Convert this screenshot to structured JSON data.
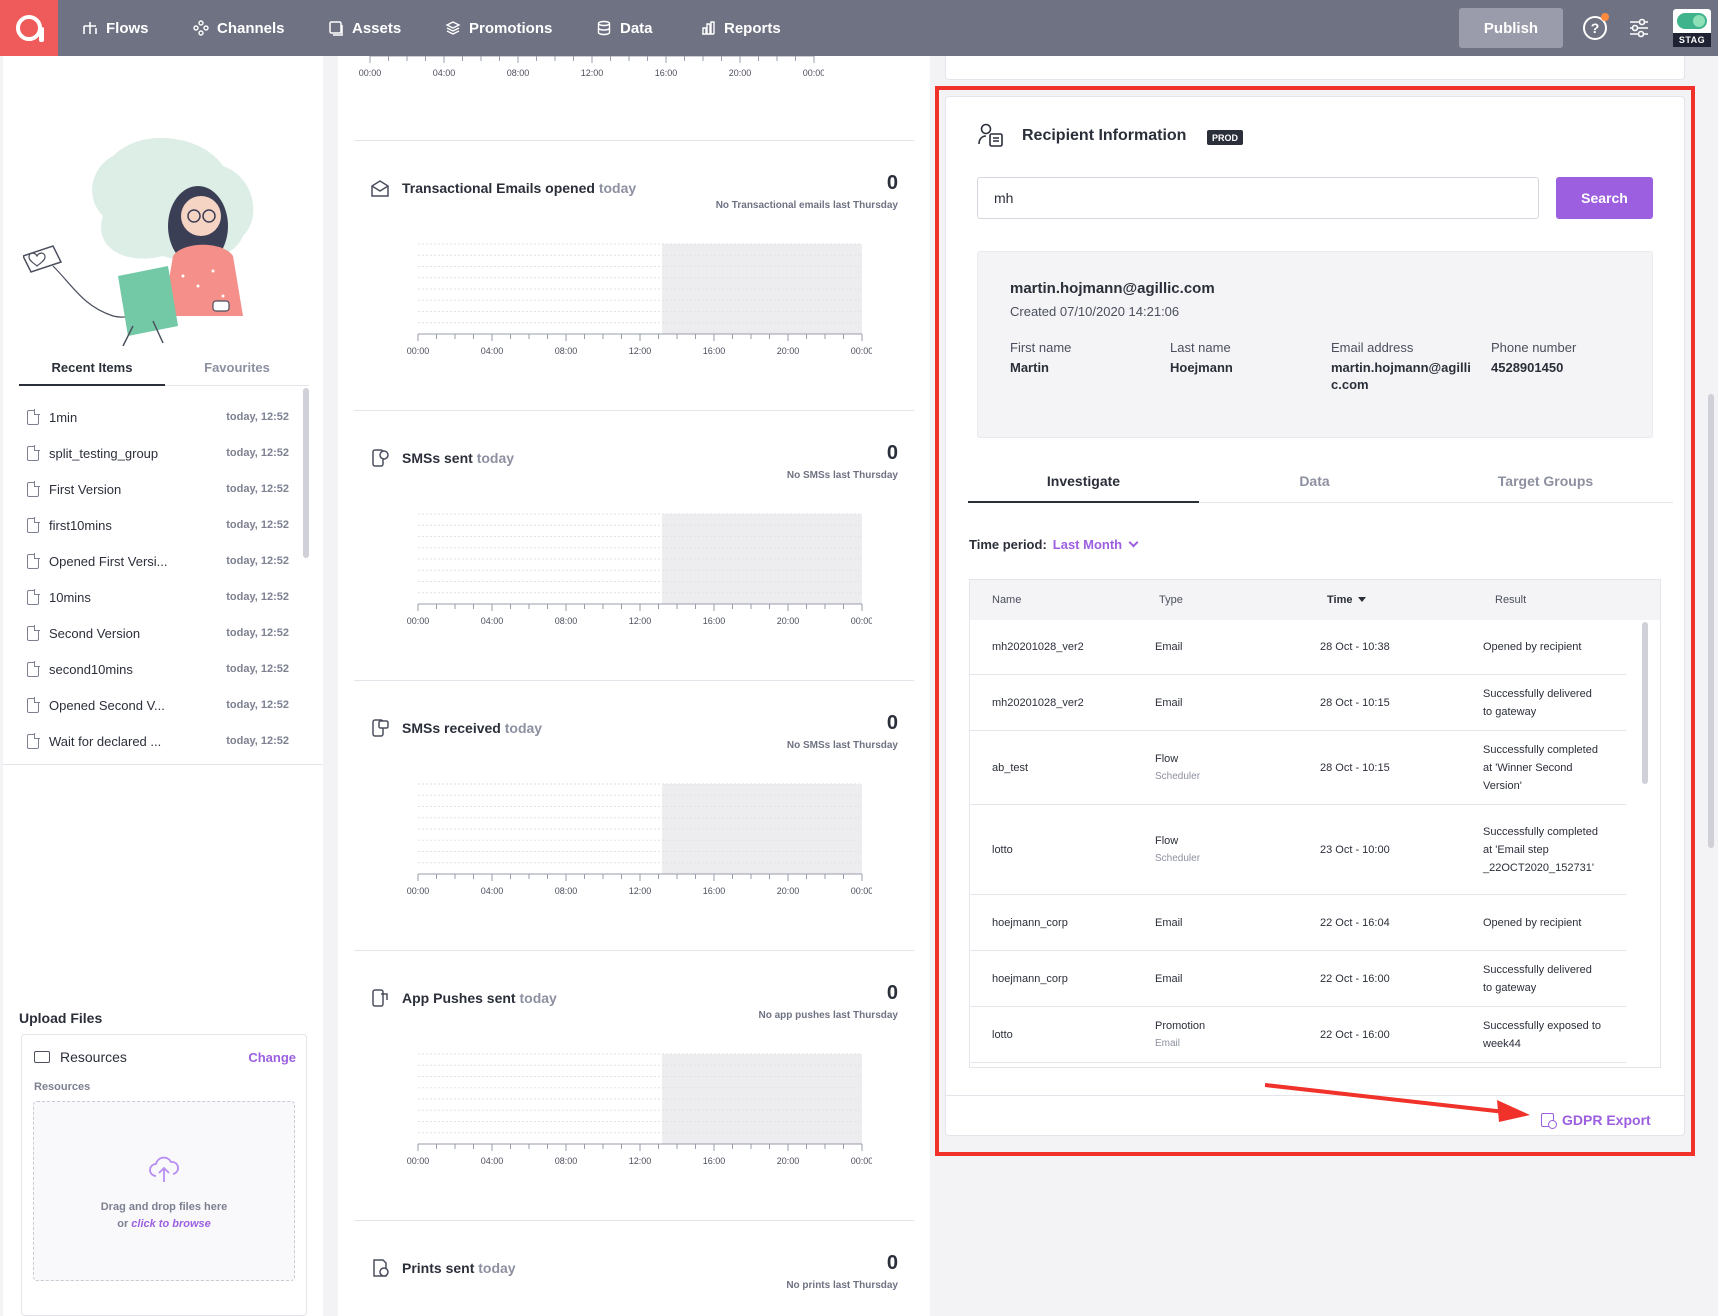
{
  "nav": {
    "items": [
      {
        "label": "Flows",
        "icon": "flows-icon"
      },
      {
        "label": "Channels",
        "icon": "channels-icon"
      },
      {
        "label": "Assets",
        "icon": "assets-icon"
      },
      {
        "label": "Promotions",
        "icon": "promotions-icon"
      },
      {
        "label": "Data",
        "icon": "database-icon"
      },
      {
        "label": "Reports",
        "icon": "reports-icon"
      }
    ],
    "publish_label": "Publish",
    "help_label": "?",
    "env_label": "STAG"
  },
  "left": {
    "tabs": {
      "recent": "Recent Items",
      "favourites": "Favourites"
    },
    "recent_items": [
      {
        "name": "1min",
        "time": "today, 12:52"
      },
      {
        "name": "split_testing_group",
        "time": "today, 12:52"
      },
      {
        "name": "First Version",
        "time": "today, 12:52"
      },
      {
        "name": "first10mins",
        "time": "today, 12:52"
      },
      {
        "name": "Opened First Versi...",
        "time": "today, 12:52"
      },
      {
        "name": "10mins",
        "time": "today, 12:52"
      },
      {
        "name": "Second Version",
        "time": "today, 12:52"
      },
      {
        "name": "second10mins",
        "time": "today, 12:52"
      },
      {
        "name": "Opened Second V...",
        "time": "today, 12:52"
      },
      {
        "name": "Wait for declared ...",
        "time": "today, 12:52"
      }
    ],
    "upload": {
      "title": "Upload Files",
      "folder_name": "Resources",
      "change_label": "Change",
      "sub_label": "Resources",
      "drop_text": "Drag and drop files here",
      "drop_or": "or",
      "drop_link": "click to browse"
    }
  },
  "chart_axis_ticks": [
    "00:00",
    "04:00",
    "08:00",
    "12:00",
    "16:00",
    "20:00",
    "00:00"
  ],
  "stats": [
    {
      "title": "Transactional Emails opened",
      "today": "today",
      "value": "0",
      "note": "No Transactional emails last Thursday",
      "icon": "envelope-open-icon"
    },
    {
      "title": "SMSs sent",
      "today": "today",
      "value": "0",
      "note": "No SMSs last Thursday",
      "icon": "sms-sent-icon"
    },
    {
      "title": "SMSs received",
      "today": "today",
      "value": "0",
      "note": "No SMSs last Thursday",
      "icon": "sms-received-icon"
    },
    {
      "title": "App Pushes sent",
      "today": "today",
      "value": "0",
      "note": "No app pushes last Thursday",
      "icon": "app-push-icon"
    },
    {
      "title": "Prints sent",
      "today": "today",
      "value": "0",
      "note": "No prints last Thursday",
      "icon": "print-icon"
    }
  ],
  "recipient": {
    "title": "Recipient Information",
    "badge": "PROD",
    "search_value": "mh",
    "search_label": "Search",
    "email": "martin.hojmann@agillic.com",
    "created": "Created 07/10/2020 14:21:06",
    "fields": [
      {
        "label": "First name",
        "value": "Martin"
      },
      {
        "label": "Last name",
        "value": "Hoejmann"
      },
      {
        "label": "Email address",
        "value": "martin.hojmann@agillic.com"
      },
      {
        "label": "Phone number",
        "value": "4528901450"
      }
    ],
    "tabs": [
      "Investigate",
      "Data",
      "Target Groups"
    ],
    "period_label": "Time period:",
    "period_value": "Last Month",
    "columns": {
      "name": "Name",
      "type": "Type",
      "time": "Time",
      "result": "Result"
    },
    "rows": [
      {
        "name": "mh20201028_ver2",
        "type": "Email",
        "sub": "",
        "time": "28 Oct - 10:38",
        "result": "Opened by recipient"
      },
      {
        "name": "mh20201028_ver2",
        "type": "Email",
        "sub": "",
        "time": "28 Oct - 10:15",
        "result": "Successfully delivered to gateway"
      },
      {
        "name": "ab_test",
        "type": "Flow",
        "sub": "Scheduler",
        "time": "28 Oct - 10:15",
        "result": "Successfully completed at 'Winner Second Version'"
      },
      {
        "name": "lotto",
        "type": "Flow",
        "sub": "Scheduler",
        "time": "23 Oct - 10:00",
        "result": "Successfully completed at 'Email step _22OCT2020_152731'"
      },
      {
        "name": "hoejmann_corp",
        "type": "Email",
        "sub": "",
        "time": "22 Oct - 16:04",
        "result": "Opened by recipient"
      },
      {
        "name": "hoejmann_corp",
        "type": "Email",
        "sub": "",
        "time": "22 Oct - 16:00",
        "result": "Successfully delivered to gateway"
      },
      {
        "name": "lotto",
        "type": "Promotion",
        "sub": "Email",
        "time": "22 Oct - 16:00",
        "result": "Successfully exposed to week44"
      }
    ],
    "gdpr_label": "GDPR Export"
  },
  "colors": {
    "accent": "#9c5fe0",
    "nav": "#6f7283",
    "logo": "#ef5a5a",
    "highlight": "#f0322a"
  }
}
